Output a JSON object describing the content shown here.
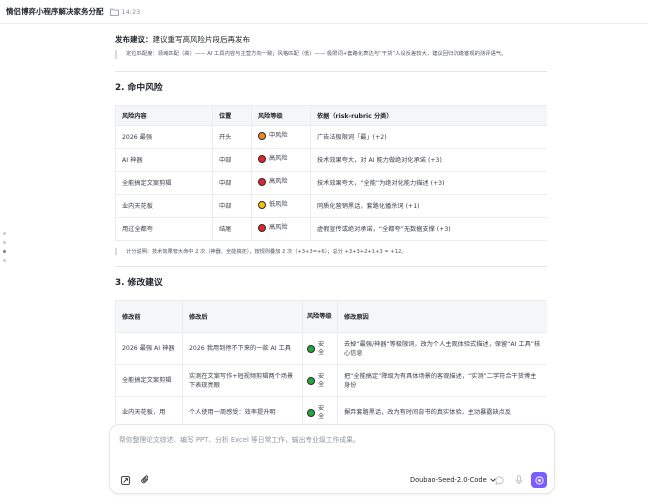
{
  "header": {
    "title": "情侣博弈小程序解决家务分配",
    "time": "14:23"
  },
  "release": {
    "label": "发布建议：",
    "text": "建议重写高风险片段后再发布"
  },
  "positioning_note": "定位匹配度：领域匹配（高）—— AI 工具内容与主营方向一致；风格匹配（低）—— 极限词+套路化表达与“干货”人设反差较大，建议回归沉稳客观的测评语气。",
  "section_risks": {
    "heading": "2. 命中风险",
    "columns": [
      "风险内容",
      "位置",
      "风险等级",
      "依据（risk-rubric 分类）"
    ],
    "rows": [
      {
        "content": "2026 最强",
        "position": "开头",
        "level": "中风险",
        "level_color": "#f28a1e",
        "basis": "广告法极限词「最」(+2)"
      },
      {
        "content": "AI 神器",
        "position": "中部",
        "level": "高风险",
        "level_color": "#e3242b",
        "basis": "技术效果夸大，对 AI 能力做绝对化承诺 (+3)"
      },
      {
        "content": "全能搞定文案剪辑",
        "position": "中部",
        "level": "高风险",
        "level_color": "#e3242b",
        "basis": "技术效果夸大，“全能”为绝对化能力描述 (+3)"
      },
      {
        "content": "业内天花板",
        "position": "中部",
        "level": "低风险",
        "level_color": "#f4c20d",
        "basis": "同质化营销黑话，套路化播杀词 (+1)"
      },
      {
        "content": "用过全都夸",
        "position": "结尾",
        "level": "高风险",
        "level_color": "#e3242b",
        "basis": "虚假宣传或绝对承诺，“全都夸”无数据支撑 (+3)"
      }
    ]
  },
  "score_note": "计分说明：技术效果夸大命中 2 次（神器、全能搞定），按规则叠加 2 次（+3+3=+6）；总分 +3+3+2+1+3 = +12。",
  "section_fixes": {
    "heading": "3. 修改建议",
    "columns": [
      "修改前",
      "修改后",
      "风险等级",
      "修改原因"
    ],
    "rows": [
      {
        "before": "2026 最强 AI 神器",
        "after": "2026 我用到停不下来的一款 AI 工具",
        "level": "安全",
        "level_color": "#23a93d",
        "reason": "去掉“最强/神器”等极限词，改为个人主观体验式描述，保留“AI 工具”核心信息"
      },
      {
        "before": "全能搞定文案剪辑",
        "after": "实测在文案写作+短视频剪辑两个场景下表现亮眼",
        "level": "安全",
        "level_color": "#23a93d",
        "reason": "把“全能搞定”降级为有具体场景的客观描述，“实测”二字符合干货博主身份"
      },
      {
        "before": "业内天花板，用",
        "after": "个人使用一周感受：效率提升明",
        "level": "安全",
        "level_color": "#23a93d",
        "reason": "摒弃套路黑话，改为有时间背书的真实体验，主动暴露缺点反"
      }
    ]
  },
  "composer": {
    "placeholder": "帮你整理论文综述、编写 PPT、分析 Excel 等日常工作，输出专业级工作成果。",
    "model_label": "Doubao-Seed-2.0-Code"
  }
}
